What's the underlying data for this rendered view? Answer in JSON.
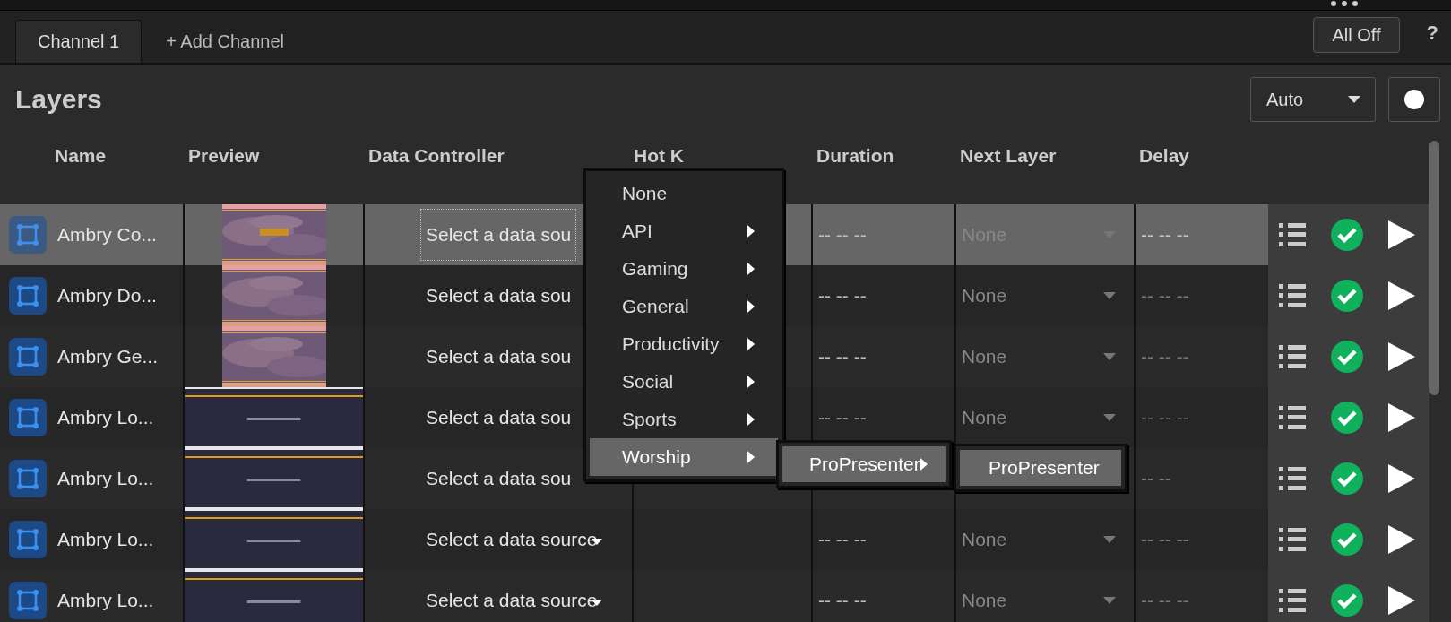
{
  "tabs": [
    {
      "label": "Channel 1",
      "selected": true
    },
    {
      "label": "+ Add Channel",
      "selected": false
    }
  ],
  "all_off_button": "All Off",
  "help": "?",
  "title": "Layers",
  "mode_dropdown": {
    "value": "Auto"
  },
  "table": {
    "columns": [
      "Name",
      "Preview",
      "Data Controller",
      "Hot K",
      "Duration",
      "Next Layer",
      "Delay"
    ],
    "rows": [
      {
        "name": "Ambry Co...",
        "selected": true,
        "focused": true,
        "data_source": "Select a data sou",
        "caret": false,
        "duration": "-- -- --",
        "next_layer": "None",
        "delay": "-- -- --"
      },
      {
        "name": "Ambry Do...",
        "selected": false,
        "focused": false,
        "data_source": "Select a data sou",
        "caret": false,
        "duration": "-- -- --",
        "next_layer": "None",
        "delay": "-- -- --"
      },
      {
        "name": "Ambry Ge...",
        "selected": false,
        "focused": false,
        "data_source": "Select a data sou",
        "caret": false,
        "duration": "-- -- --",
        "next_layer": "None",
        "delay": "-- -- --"
      },
      {
        "name": "Ambry Lo...",
        "selected": false,
        "focused": false,
        "data_source": "Select a data sou",
        "caret": false,
        "duration": "-- -- --",
        "next_layer": "None",
        "delay": "-- -- --"
      },
      {
        "name": "Ambry Lo...",
        "selected": false,
        "focused": false,
        "data_source": "Select a data sou",
        "caret": false,
        "delay": "-- --"
      },
      {
        "name": "Ambry Lo...",
        "selected": false,
        "focused": false,
        "data_source": "Select a data source",
        "caret": true,
        "duration": "-- -- --",
        "next_layer": "None",
        "delay": "-- -- --"
      },
      {
        "name": "Ambry Lo...",
        "selected": false,
        "focused": false,
        "data_source": "Select a data source",
        "caret": true,
        "duration": "-- -- --",
        "next_layer": "None",
        "delay": "-- -- --"
      }
    ]
  },
  "data_source_menu": {
    "items": [
      {
        "label": "None",
        "submenu": false,
        "selected": false
      },
      {
        "label": "API",
        "submenu": true,
        "selected": false
      },
      {
        "label": "Gaming",
        "submenu": true,
        "selected": false
      },
      {
        "label": "General",
        "submenu": true,
        "selected": false
      },
      {
        "label": "Productivity",
        "submenu": true,
        "selected": false
      },
      {
        "label": "Social",
        "submenu": true,
        "selected": false
      },
      {
        "label": "Sports",
        "submenu": true,
        "selected": false
      },
      {
        "label": "Worship",
        "submenu": true,
        "selected": true
      }
    ]
  },
  "worship_menu": {
    "items": [
      {
        "label": "ProPresenter",
        "submenu": true,
        "selected": true
      }
    ]
  },
  "propresenter_menu": {
    "items": [
      {
        "label": "ProPresenter",
        "submenu": false,
        "selected": true
      }
    ]
  }
}
